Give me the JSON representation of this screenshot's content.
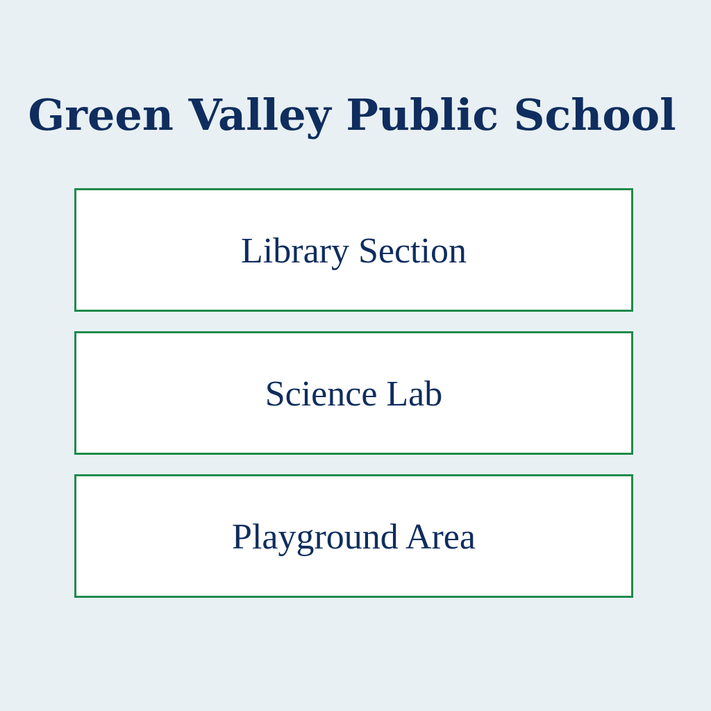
{
  "header": {
    "title": "Green Valley Public School"
  },
  "sections": {
    "items": [
      {
        "label": "Library Section"
      },
      {
        "label": "Science Lab"
      },
      {
        "label": "Playground Area"
      }
    ]
  },
  "colors": {
    "background": "#e8f0f3",
    "text": "#0f2d5e",
    "border": "#1f8a4c",
    "card": "#ffffff"
  }
}
